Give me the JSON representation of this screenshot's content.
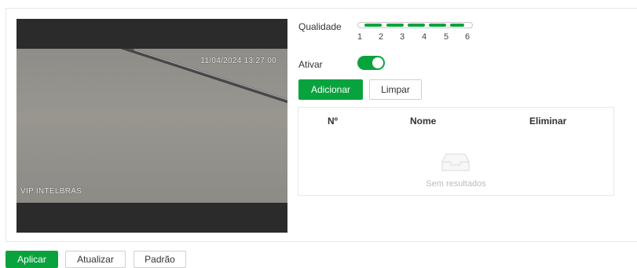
{
  "video": {
    "timestamp": "11/04/2024 13:27:00",
    "camera_name": "VIP INTELBRAS"
  },
  "quality": {
    "label": "Qualidade",
    "levels": [
      "1",
      "2",
      "3",
      "4",
      "5",
      "6"
    ],
    "selected": 6,
    "color": "#09a33e"
  },
  "enable": {
    "label": "Ativar",
    "on": true
  },
  "actions": {
    "add_label": "Adicionar",
    "clear_label": "Limpar"
  },
  "table": {
    "columns": [
      "Nº",
      "Nome",
      "Eliminar"
    ],
    "rows": [],
    "empty_text": "Sem resultados",
    "empty_icon": "inbox-icon"
  },
  "footer": {
    "apply_label": "Aplicar",
    "refresh_label": "Atualizar",
    "default_label": "Padrão"
  },
  "colors": {
    "accent": "#09a33e"
  }
}
